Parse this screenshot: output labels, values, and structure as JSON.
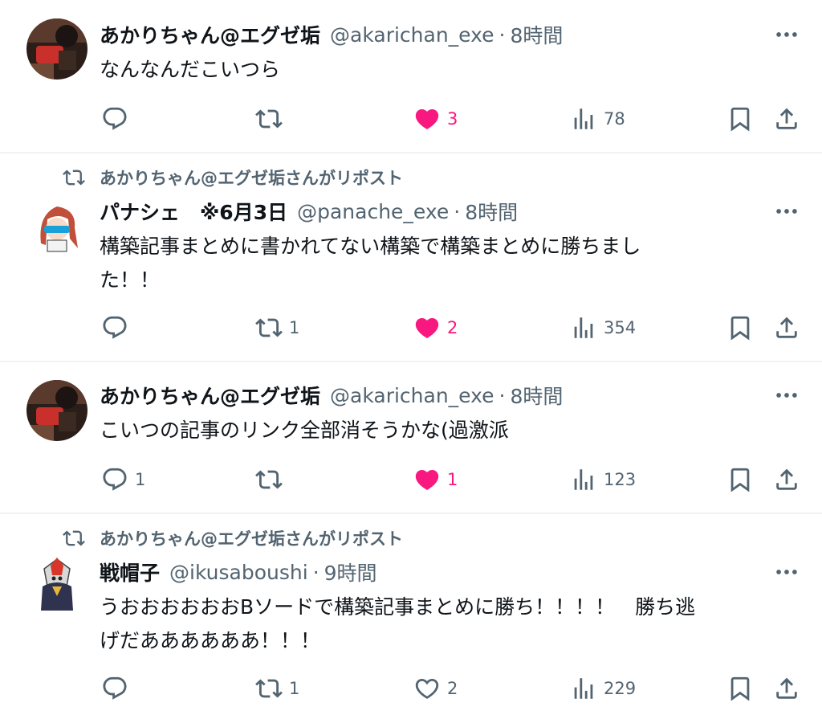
{
  "tweets": [
    {
      "repost_label": "",
      "name": "あかりちゃん@エグゼ垢",
      "handle": "@akarichan_exe",
      "dot": "·",
      "time": "8時間",
      "text": "なんなんだこいつら",
      "reply_count": "",
      "repost_count": "",
      "like_count": "3",
      "liked": true,
      "view_count": "78"
    },
    {
      "repost_label": "あかりちゃん@エグゼ垢さんがリポスト",
      "name": "パナシェ　※6月3日",
      "handle": "@panache_exe",
      "dot": "·",
      "time": "8時間",
      "text": "構築記事まとめに書かれてない構築で構築まとめに勝ちまし\nた！！",
      "reply_count": "",
      "repost_count": "1",
      "like_count": "2",
      "liked": true,
      "view_count": "354"
    },
    {
      "repost_label": "",
      "name": "あかりちゃん@エグゼ垢",
      "handle": "@akarichan_exe",
      "dot": "·",
      "time": "8時間",
      "text": "こいつの記事のリンク全部消そうかな(過激派",
      "reply_count": "1",
      "repost_count": "",
      "like_count": "1",
      "liked": true,
      "view_count": "123"
    },
    {
      "repost_label": "あかりちゃん@エグゼ垢さんがリポスト",
      "name": "戦帽子",
      "handle": "@ikusaboushi",
      "dot": "·",
      "time": "9時間",
      "text": "うおおおおおおBソードで構築記事まとめに勝ち！！！！　勝ち逃\nげだああああああ！！！",
      "reply_count": "",
      "repost_count": "1",
      "like_count": "2",
      "liked": false,
      "view_count": "229"
    }
  ],
  "icons": {
    "reply": "reply-icon",
    "repost": "repost-icon",
    "like": "heart-icon",
    "views": "views-icon",
    "bookmark": "bookmark-icon",
    "share": "share-icon",
    "more": "more-icon"
  },
  "colors": {
    "text": "#0f1419",
    "secondary": "#536471",
    "like": "#f91880",
    "divider": "#eff3f4"
  }
}
